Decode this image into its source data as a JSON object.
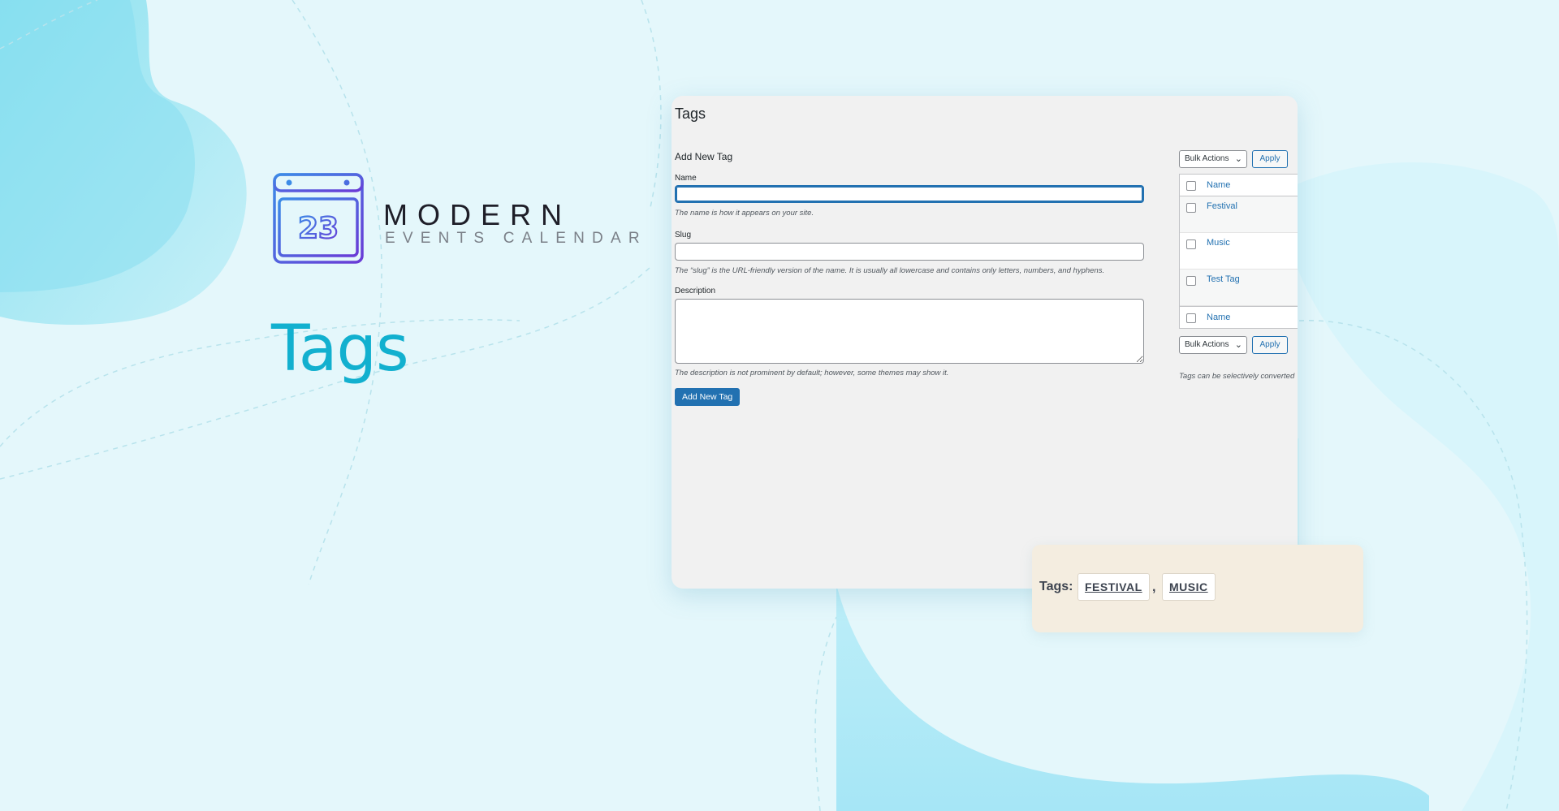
{
  "branding": {
    "logo_number": "23",
    "title": "MODERN",
    "subtitle": "EVENTS CALENDAR"
  },
  "hero": {
    "title": "Tags"
  },
  "colors": {
    "accent": "#12b0cf",
    "wp_primary": "#2271b1",
    "logo_gradient_start": "#3c8ce7",
    "logo_gradient_end": "#6a3ad6",
    "tagbar_bg": "#f4ede0"
  },
  "panel": {
    "title": "Tags",
    "form": {
      "heading": "Add New Tag",
      "name_label": "Name",
      "name_value": "",
      "name_hint": "The name is how it appears on your site.",
      "slug_label": "Slug",
      "slug_value": "",
      "slug_hint": "The “slug” is the URL-friendly version of the name. It is usually all lowercase and contains only letters, numbers, and hyphens.",
      "description_label": "Description",
      "description_value": "",
      "description_hint": "The description is not prominent by default; however, some themes may show it.",
      "submit_label": "Add New Tag"
    },
    "table": {
      "bulk_actions_label": "Bulk Actions",
      "apply_label": "Apply",
      "column_name": "Name",
      "rows": [
        {
          "name": "Festival"
        },
        {
          "name": "Music"
        },
        {
          "name": "Test Tag"
        }
      ],
      "footer_column_name": "Name",
      "note": "Tags can be selectively converted"
    }
  },
  "tagbar": {
    "label": "Tags:",
    "separator": ",",
    "tags": [
      "FESTIVAL",
      "MUSIC"
    ]
  }
}
